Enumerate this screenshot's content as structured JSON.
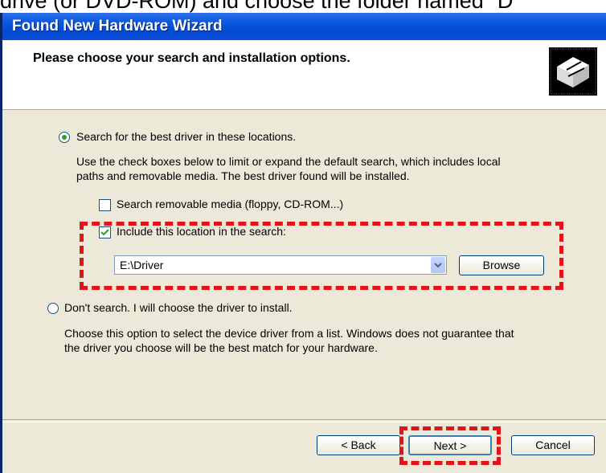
{
  "caption": "drive (or DVD-ROM) and choose the folder named \"D",
  "window": {
    "title": "Found New Hardware Wizard"
  },
  "header": {
    "heading": "Please choose your search and installation options."
  },
  "options": {
    "search_radio_label": "Search for the best driver in these locations.",
    "search_description_line1": "Use the check boxes below to limit or expand the default search, which includes local",
    "search_description_line2": "paths and removable media. The best driver found will be installed.",
    "removable_media_label": "Search removable media (floppy, CD-ROM...)",
    "removable_media_checked": false,
    "include_location_label": "Include this location in the search:",
    "include_location_checked": true,
    "location_value": "E:\\Driver",
    "browse_label": "Browse",
    "dont_search_label": "Don't search. I will choose the driver to install.",
    "dont_search_description_line1": "Choose this option to select the device driver from a list.  Windows does not guarantee that",
    "dont_search_description_line2": "the driver you choose will be the best match for your hardware.",
    "selected_option": "search"
  },
  "buttons": {
    "back": "< Back",
    "next": "Next >",
    "cancel": "Cancel"
  },
  "colors": {
    "highlight_dash": "#e3131b",
    "titlebar": "#0349d2",
    "radio_dot": "#21a121",
    "dialog_bg": "#ece9d8"
  }
}
